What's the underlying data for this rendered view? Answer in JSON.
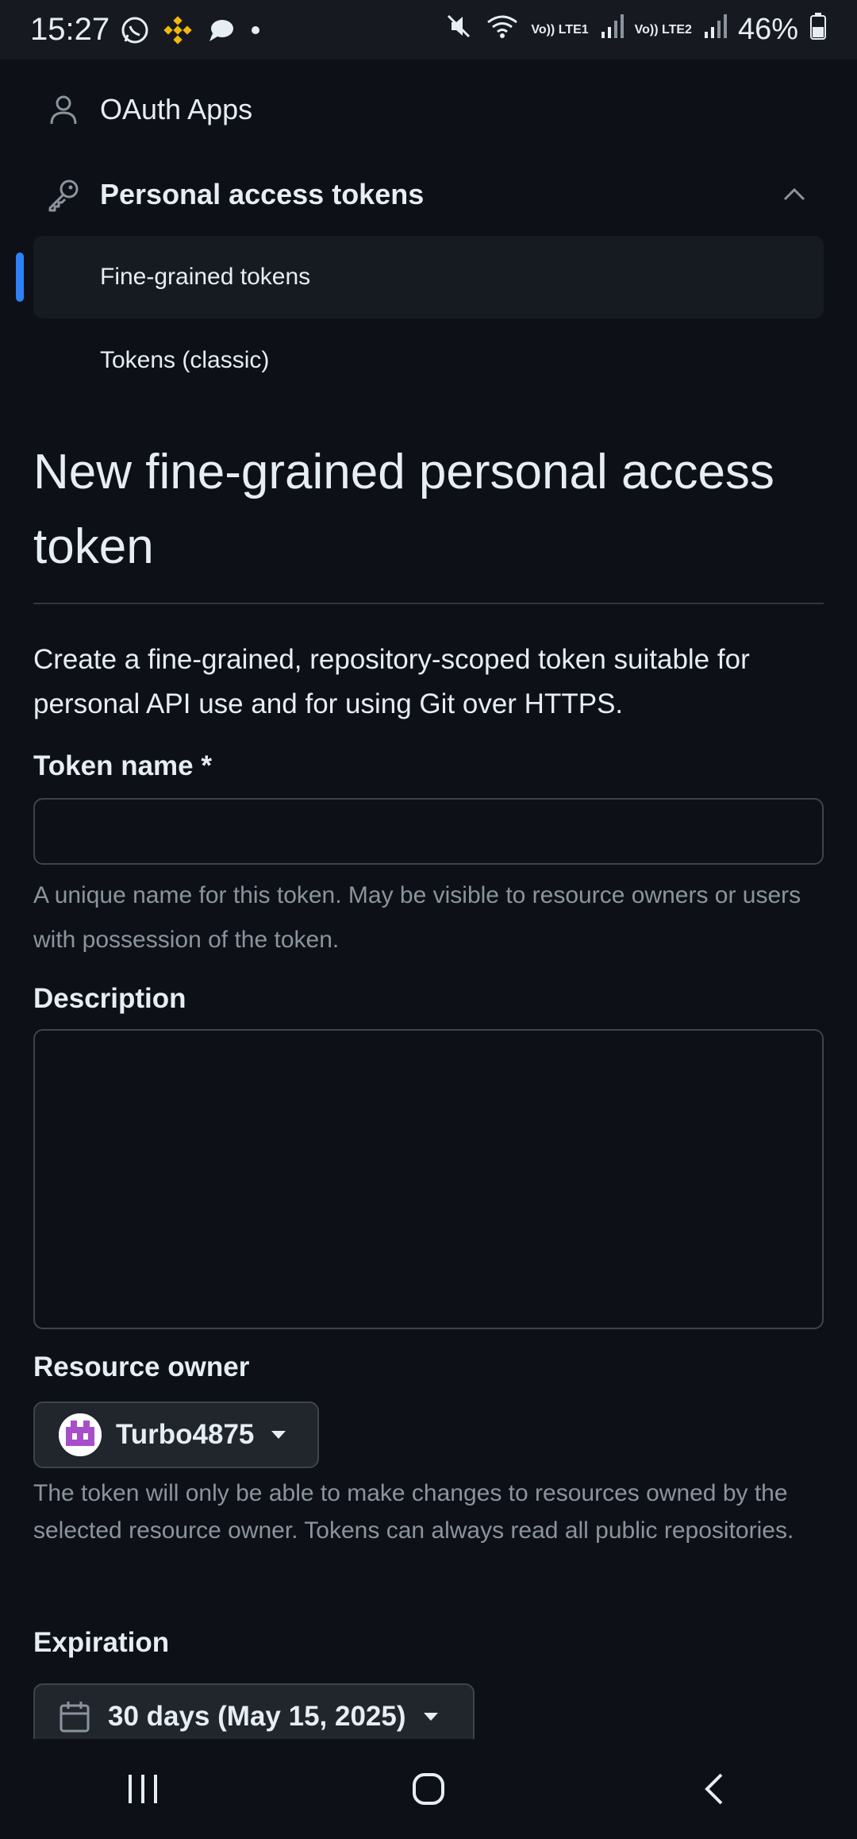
{
  "status_bar": {
    "time": "15:27",
    "battery": "46%",
    "sim1_label": "Vo)) LTE1",
    "sim2_label": "Vo)) LTE2"
  },
  "sidebar": {
    "oauth_apps": "OAuth Apps",
    "personal_access_tokens": "Personal access tokens",
    "fine_grained_tokens": "Fine-grained tokens",
    "tokens_classic": "Tokens (classic)"
  },
  "page": {
    "title": "New fine-grained personal access token",
    "intro": "Create a fine-grained, repository-scoped token suitable for personal API use and for using Git over HTTPS."
  },
  "form": {
    "token_name_label": "Token name *",
    "token_name_value": "",
    "token_name_help": "A unique name for this token. May be visible to resource owners or users with possession of the token.",
    "description_label": "Description",
    "description_value": "",
    "resource_owner_label": "Resource owner",
    "resource_owner_value": "Turbo4875",
    "resource_owner_help": "The token will only be able to make changes to resources owned by the selected resource owner. Tokens can always read all public repositories.",
    "expiration_label": "Expiration",
    "expiration_value": "30 days (May 15, 2025)"
  },
  "colors": {
    "background": "#0d1117",
    "accent": "#2f81f7",
    "border": "#3d444d",
    "muted_text": "#8b949e"
  },
  "icons": [
    "whatsapp-icon",
    "binance-icon",
    "chat-icon",
    "mute-icon",
    "wifi-icon",
    "signal-icon",
    "battery-icon",
    "person-icon",
    "key-icon",
    "chevron-up-icon",
    "caret-down-icon",
    "calendar-icon",
    "recent-apps-icon",
    "home-icon",
    "back-icon"
  ]
}
